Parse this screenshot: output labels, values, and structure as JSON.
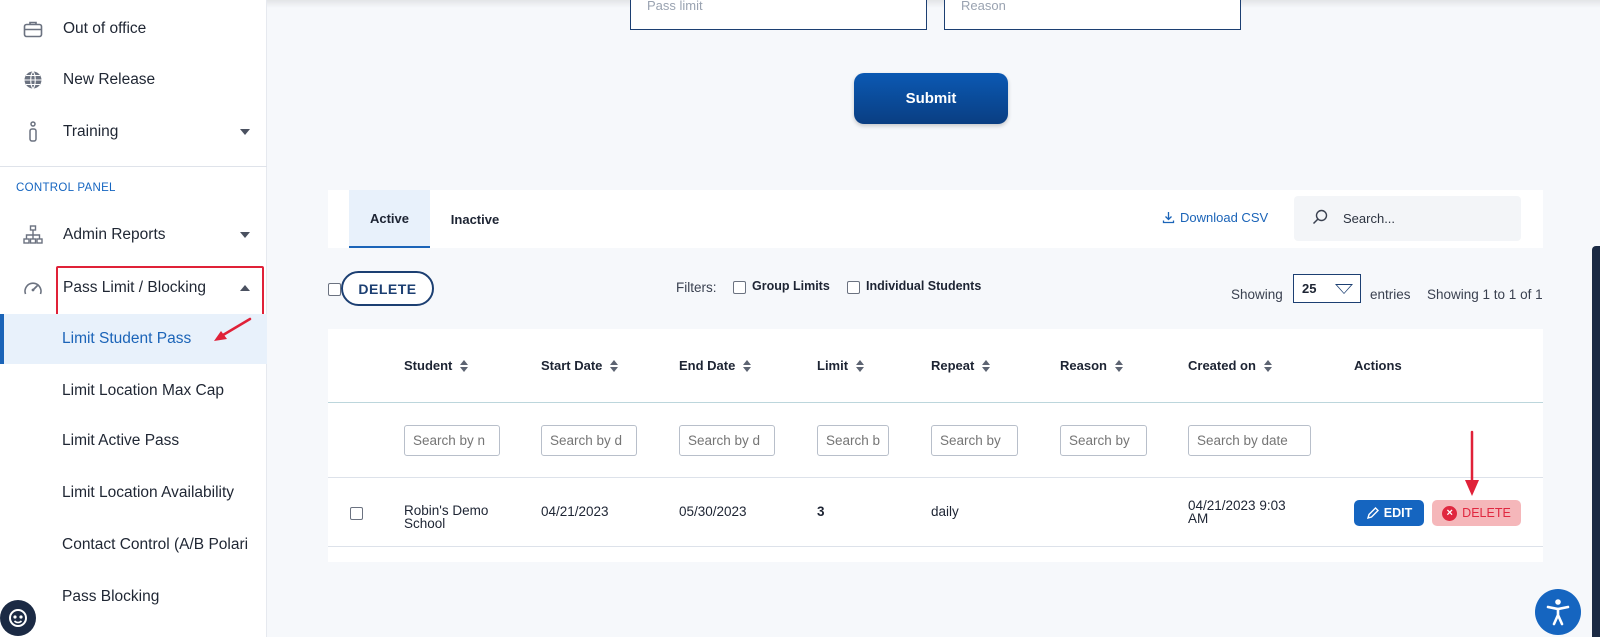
{
  "sidebar": {
    "items": [
      {
        "label": "Out of office",
        "icon": "briefcase-icon"
      },
      {
        "label": "New Release",
        "icon": "globe-icon"
      },
      {
        "label": "Training",
        "icon": "info-icon"
      }
    ],
    "section_label": "CONTROL PANEL",
    "panel_items": [
      {
        "label": "Admin Reports",
        "icon": "sitemap-icon"
      },
      {
        "label": "Pass Limit / Blocking",
        "icon": "speedometer-icon"
      }
    ],
    "sub_items": [
      "Limit Student Pass",
      "Limit Location Max Cap",
      "Limit Active Pass",
      "Limit Location Availability",
      "Contact Control (A/B Polari",
      "Pass Blocking"
    ]
  },
  "form": {
    "pass_limit_placeholder": "Pass limit",
    "reason_placeholder": "Reason",
    "submit_label": "Submit"
  },
  "tabs": {
    "active": "Active",
    "inactive": "Inactive"
  },
  "toolbar": {
    "download_label": "Download CSV",
    "search_placeholder": "Search...",
    "delete_label": "DELETE",
    "filters_label": "Filters:",
    "filter_group": "Group Limits",
    "filter_individual": "Individual Students",
    "showing_label": "Showing",
    "entries_value": "25",
    "entries_label": "entries",
    "showing_summary": "Showing 1 to 1 of 1"
  },
  "table": {
    "headers": [
      "Student",
      "Start Date",
      "End Date",
      "Limit",
      "Repeat",
      "Reason",
      "Created on",
      "Actions"
    ],
    "search_placeholders": [
      "Search by n",
      "Search by d",
      "Search by d",
      "Search b",
      "Search by",
      "Search by",
      "Search by date"
    ],
    "row": {
      "student_line1": "Robin's Demo",
      "student_line2": "School",
      "start_date": "04/21/2023",
      "end_date": "05/30/2023",
      "limit": "3",
      "repeat": "daily",
      "reason": "",
      "created_line1": "04/21/2023 9:03",
      "created_line2": "AM",
      "edit_label": "EDIT",
      "delete_label": "DELETE"
    }
  },
  "colors": {
    "brand": "#0a3e82",
    "accent": "#1565c0",
    "danger": "#e0273f",
    "annotation": "#e02138"
  }
}
